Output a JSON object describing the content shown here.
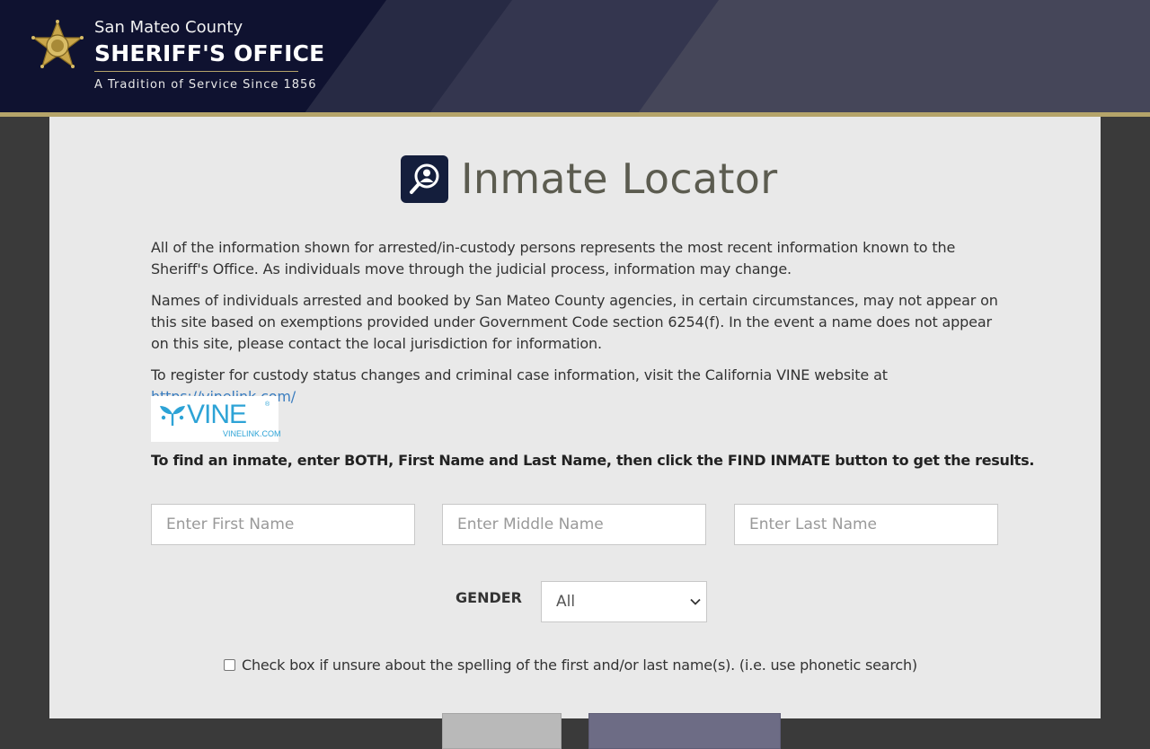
{
  "header": {
    "county": "San Mateo County",
    "office": "SHERIFF'S OFFICE",
    "tagline": "A Tradition of Service Since 1856",
    "badge_icon": "sheriff-star-badge-icon"
  },
  "page": {
    "title": "Inmate Locator",
    "title_icon": "person-search-icon",
    "paragraph1": "All of the information shown for arrested/in-custody persons represents the most recent information known to the Sheriff's Office. As individuals move through the judicial process, information may change.",
    "paragraph2": "Names of individuals arrested and booked by San Mateo County agencies, in certain circumstances, may not appear on this site based on exemptions provided under Government Code section 6254(f). In the event a name does not appear on this site, please contact the local jurisdiction for information.",
    "paragraph3_text": "To register for custody status changes and criminal case information, visit the California VINE website at",
    "vine_link": "https://vinelink.com/",
    "instructions": "To find an inmate, enter BOTH, First Name and Last Name, then click the FIND INMATE button to get the results."
  },
  "vine_logo": {
    "word": "VINE",
    "registered": "®",
    "sub": "VINELINK.COM"
  },
  "form": {
    "first_name_placeholder": "Enter First Name",
    "middle_name_placeholder": "Enter Middle Name",
    "last_name_placeholder": "Enter Last Name",
    "gender_label": "GENDER",
    "gender_value": "All",
    "phonetic_label": "Check box if unsure about the spelling of the first and/or last name(s). (i.e. use phonetic search)"
  },
  "colors": {
    "header_dark": "#0f1230",
    "gold": "#b5a46a",
    "title_icon_bg": "#141e3c",
    "link": "#3b7dbf",
    "vine_blue": "#2da3d6",
    "find_button": "#6d6c85"
  }
}
